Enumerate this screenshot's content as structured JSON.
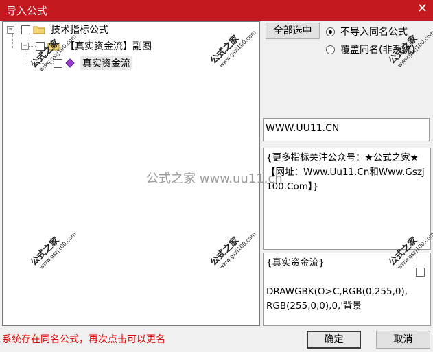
{
  "window": {
    "title": "导入公式",
    "close_glyph": "✕"
  },
  "tree": {
    "root": {
      "label": "技术指标公式",
      "toggle": "−"
    },
    "child": {
      "label": "【真实资金流】副图",
      "toggle": "−"
    },
    "leaf": {
      "label": "真实资金流"
    }
  },
  "select_all_label": "全部选中",
  "options": {
    "no_import_same": "不导入同名公式",
    "overwrite_same": "覆盖同名(非系统)",
    "selected": "no_import_same"
  },
  "url_field": "WWW.UU11.CN",
  "description": "{更多指标关注公众号：★公式之家★【网址：Www.Uu11.Cn和Www.Gszj100.Com】}",
  "formula_preview": "{真实资金流}\n\nDRAWGBK(O>C,RGB(0,255,0),RGB(255,0,0),0,'背景",
  "status_message": "系统存在同名公式，再次点击可以更名",
  "ok_label": "确定",
  "cancel_label": "取消",
  "watermark": {
    "brand": "公式之家",
    "url": "www.gszj100.com",
    "center": "公式之家 www.uu11.cn"
  },
  "colors": {
    "titlebar": "#c41a1f",
    "status": "#e00000"
  }
}
